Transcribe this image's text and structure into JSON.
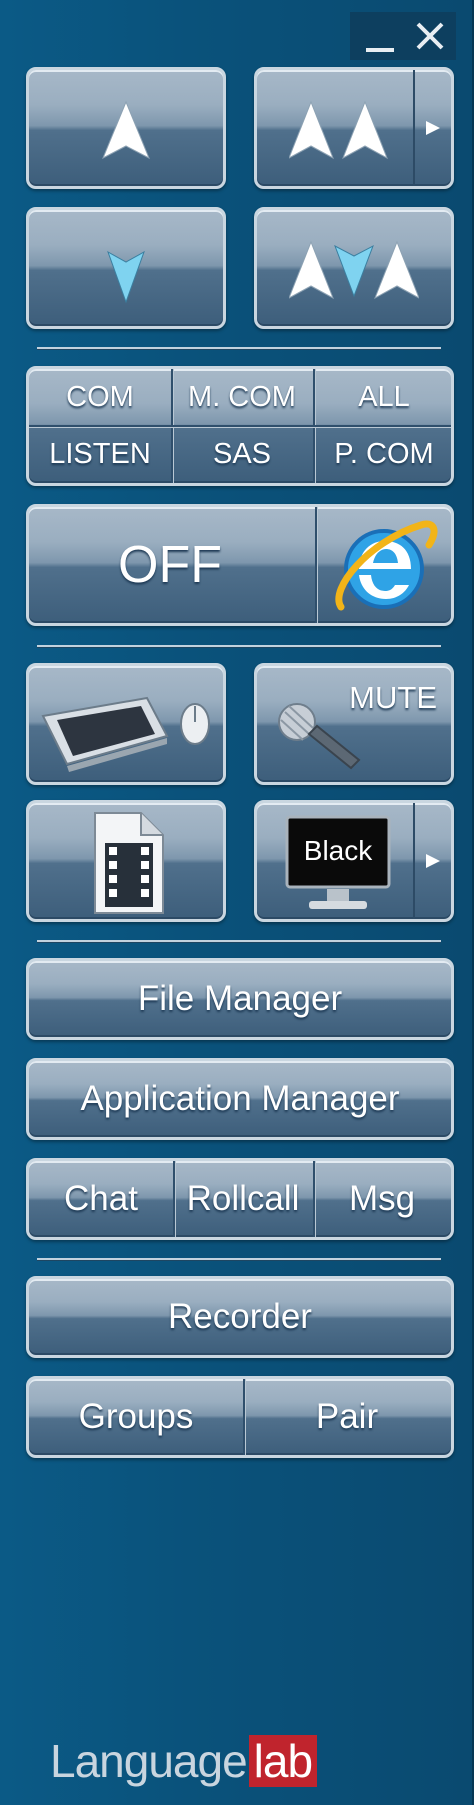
{
  "window": {
    "minimize_icon": "minimize-icon",
    "close_icon": "close-icon"
  },
  "nav": {
    "up_icon": "arrow-up-icon",
    "up_all_icon": "double-arrow-up-icon",
    "down_icon": "arrow-down-icon",
    "mixed_icon": "mixed-arrows-icon"
  },
  "modes": {
    "row1": [
      "COM",
      "M. COM",
      "ALL"
    ],
    "row2": [
      "LISTEN",
      "SAS",
      "P. COM"
    ]
  },
  "internet": {
    "state_label": "OFF",
    "browser_icon": "internet-explorer-icon"
  },
  "devices": {
    "keyboard_icon": "keyboard-mouse-icon",
    "mic_label": "MUTE",
    "media_icon": "video-file-icon",
    "screen_label": "Black"
  },
  "tools": {
    "file_manager": "File Manager",
    "application_manager": "Application Manager",
    "chat": "Chat",
    "rollcall": "Rollcall",
    "msg": "Msg",
    "recorder": "Recorder",
    "groups": "Groups",
    "pair": "Pair"
  },
  "brand": {
    "name_part": "Language",
    "lab_part": "lab"
  },
  "colors": {
    "background": "#0a4f77",
    "button_border": "#c9d6e0",
    "arrow_white": "#ffffff",
    "arrow_cyan": "#7fd3f0",
    "brand_red": "#c0242d"
  }
}
